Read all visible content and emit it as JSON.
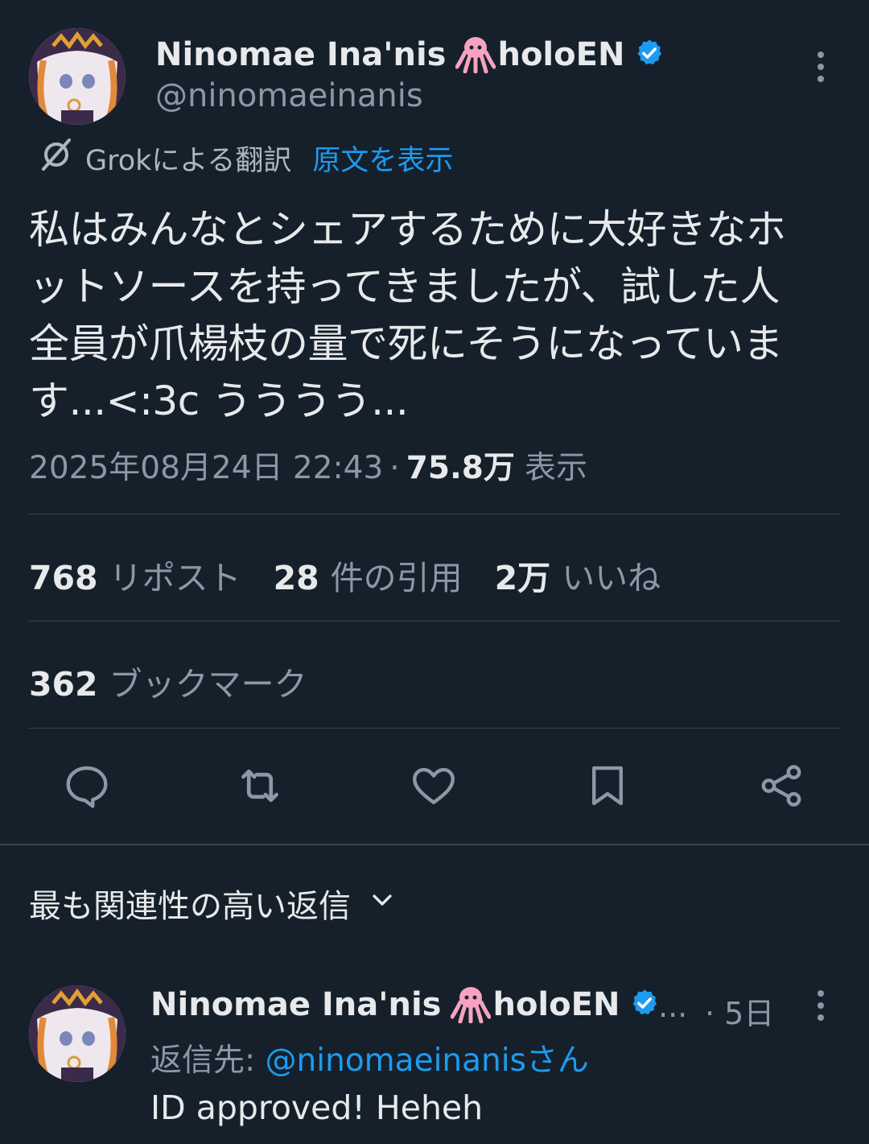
{
  "tweet": {
    "author": {
      "display_name": "Ninomae Ina'nis",
      "name_suffix": "holoEN",
      "handle": "@ninomaeinanis",
      "emoji": "octopus",
      "verified": true
    },
    "translation": {
      "label": "Grokによる翻訳",
      "show_original": "原文を表示",
      "icon": "grok-icon"
    },
    "text_lines": [
      "私はみんなとシェアするために大好きなホ",
      "ットソースを持ってきましたが、試した人",
      "全員が爪楊枝の量で死にそうになっていま",
      "す...<:3c うううう..."
    ],
    "timestamp": "2025年08月24日 22:43",
    "separator": "·",
    "views_count": "75.8万",
    "views_label": "表示",
    "stats": {
      "reposts": {
        "count": "768",
        "label": "リポスト"
      },
      "quotes": {
        "count": "28",
        "label": "件の引用"
      },
      "likes": {
        "count": "2万",
        "label": "いいね"
      },
      "bookmarks": {
        "count": "362",
        "label": "ブックマーク"
      }
    },
    "actions": [
      "reply-icon",
      "repost-icon",
      "like-icon",
      "bookmark-icon",
      "share-icon"
    ]
  },
  "replies": {
    "sort_label": "最も関連性の高い返信",
    "items": [
      {
        "display_name": "Ninomae Ina'nis",
        "name_suffix": "holoEN",
        "ellipsis": "...",
        "age": "· 5日",
        "reply_to_prefix": "返信先: ",
        "reply_to_handle": "@ninomaeinanis",
        "reply_to_suffix": "さん",
        "text": "ID approved! Heheh"
      }
    ]
  },
  "colors": {
    "background": "#15202b",
    "text": "#e7e9ea",
    "muted": "#8b98a5",
    "accent": "#1d9bf0",
    "divider": "#38444d",
    "verified": "#1d9bf0",
    "octopus": "#f7a2c0"
  }
}
